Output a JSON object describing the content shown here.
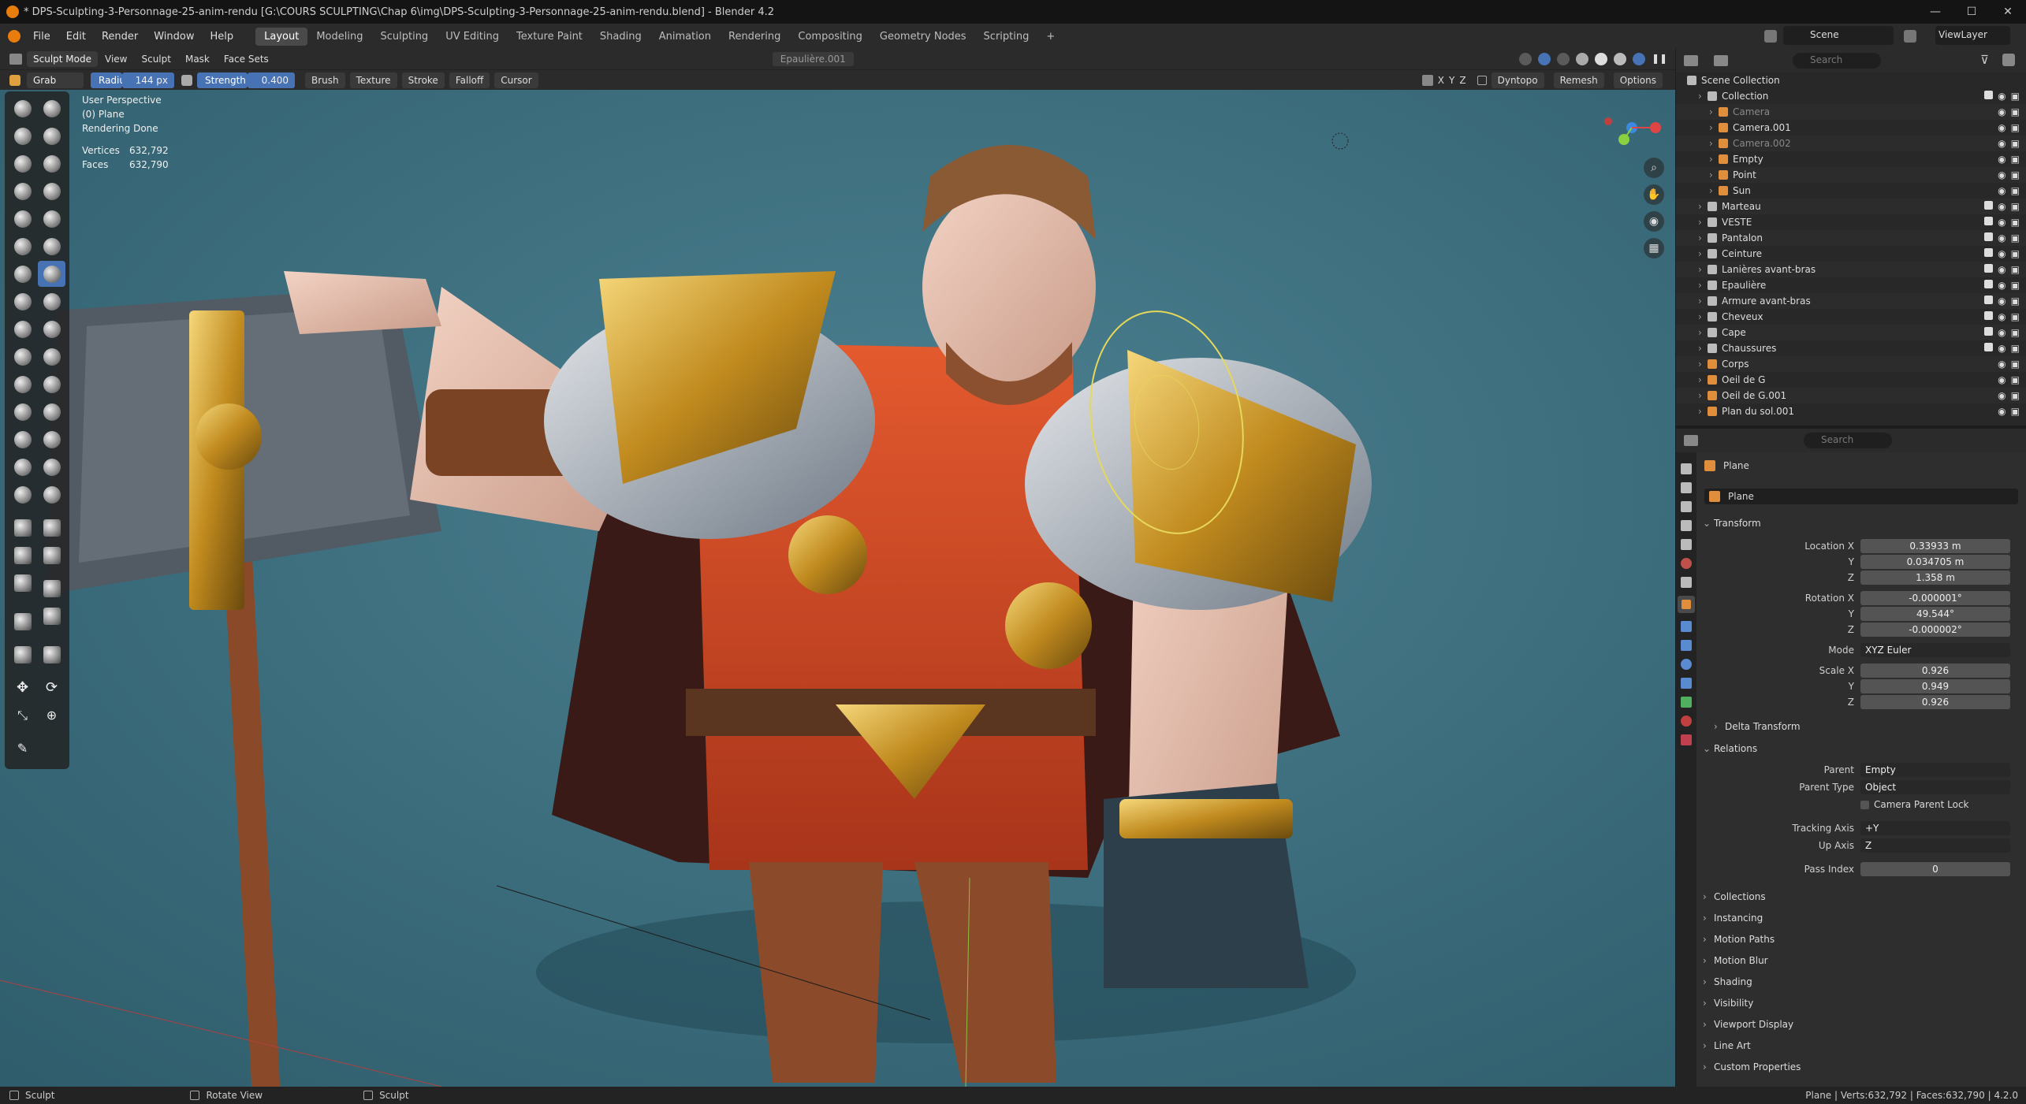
{
  "window": {
    "title": "* DPS-Sculpting-3-Personnage-25-anim-rendu [G:\\COURS SCULPTING\\Chap 6\\img\\DPS-Sculpting-3-Personnage-25-anim-rendu.blend] - Blender 4.2"
  },
  "menu": [
    "File",
    "Edit",
    "Render",
    "Window",
    "Help"
  ],
  "workspaces": [
    "Layout",
    "Modeling",
    "Sculpting",
    "UV Editing",
    "Texture Paint",
    "Shading",
    "Animation",
    "Rendering",
    "Compositing",
    "Geometry Nodes",
    "Scripting"
  ],
  "active_workspace": "Layout",
  "scene": {
    "name": "Scene",
    "view_layer": "ViewLayer"
  },
  "viewport_header": {
    "mode": "Sculpt Mode",
    "menus": [
      "View",
      "Sculpt",
      "Mask",
      "Face Sets"
    ],
    "object_field": "Epaulière.001"
  },
  "tool_header": {
    "tool": "Grab",
    "radius_label": "Radius",
    "radius_value": "144 px",
    "strength_label": "Strength",
    "strength_value": "0.400",
    "menus": [
      "Brush",
      "Texture",
      "Stroke",
      "Falloff",
      "Cursor"
    ],
    "axes": [
      "X",
      "Y",
      "Z"
    ],
    "dyntopo": "Dyntopo",
    "remesh": "Remesh",
    "options": "Options"
  },
  "viewport_info": {
    "view": "User Perspective",
    "object": "(0) Plane",
    "status": "Rendering Done",
    "vertices_label": "Vertices",
    "vertices": "632,792",
    "faces_label": "Faces",
    "faces": "632,790"
  },
  "outliner": {
    "search_placeholder": "Search",
    "root": "Scene Collection",
    "items": [
      {
        "name": "Collection",
        "depth": 1,
        "color": "#bbbbbb"
      },
      {
        "name": "Camera",
        "depth": 2,
        "color": "#e08d3c",
        "dim": true
      },
      {
        "name": "Camera.001",
        "depth": 2,
        "color": "#e08d3c"
      },
      {
        "name": "Camera.002",
        "depth": 2,
        "color": "#e08d3c",
        "dim": true
      },
      {
        "name": "Empty",
        "depth": 2,
        "color": "#e08d3c"
      },
      {
        "name": "Point",
        "depth": 2,
        "color": "#e08d3c"
      },
      {
        "name": "Sun",
        "depth": 2,
        "color": "#e08d3c"
      },
      {
        "name": "Marteau",
        "depth": 1,
        "color": "#bbbbbb"
      },
      {
        "name": "VESTE",
        "depth": 1,
        "color": "#bbbbbb"
      },
      {
        "name": "Pantalon",
        "depth": 1,
        "color": "#bbbbbb"
      },
      {
        "name": "Ceinture",
        "depth": 1,
        "color": "#bbbbbb"
      },
      {
        "name": "Lanières avant-bras",
        "depth": 1,
        "color": "#bbbbbb"
      },
      {
        "name": "Epaulière",
        "depth": 1,
        "color": "#bbbbbb"
      },
      {
        "name": "Armure avant-bras",
        "depth": 1,
        "color": "#bbbbbb"
      },
      {
        "name": "Cheveux",
        "depth": 1,
        "color": "#bbbbbb"
      },
      {
        "name": "Cape",
        "depth": 1,
        "color": "#bbbbbb"
      },
      {
        "name": "Chaussures",
        "depth": 1,
        "color": "#bbbbbb"
      },
      {
        "name": "Corps",
        "depth": 1,
        "color": "#e08d3c"
      },
      {
        "name": "Oeil de G",
        "depth": 1,
        "color": "#e08d3c"
      },
      {
        "name": "Oeil de G.001",
        "depth": 1,
        "color": "#e08d3c"
      },
      {
        "name": "Plan du sol.001",
        "depth": 1,
        "color": "#e08d3c"
      }
    ]
  },
  "properties": {
    "search_placeholder": "Search",
    "object_name": "Plane",
    "data_name": "Plane",
    "transform_label": "Transform",
    "location": {
      "label": "Location X",
      "x": "0.33933 m",
      "y": "0.034705 m",
      "z": "1.358 m"
    },
    "rotation": {
      "label": "Rotation X",
      "x": "-0.000001°",
      "y": "49.544°",
      "z": "-0.000002°"
    },
    "mode_label": "Mode",
    "mode": "XYZ Euler",
    "scale": {
      "label": "Scale X",
      "x": "0.926",
      "y": "0.949",
      "z": "0.926"
    },
    "axis_y": "Y",
    "axis_z": "Z",
    "delta_transform": "Delta Transform",
    "relations_label": "Relations",
    "parent_label": "Parent",
    "parent": "Empty",
    "parent_type_label": "Parent Type",
    "parent_type": "Object",
    "camera_parent_lock": "Camera Parent Lock",
    "tracking_axis_label": "Tracking Axis",
    "tracking_axis": "+Y",
    "up_axis_label": "Up Axis",
    "up_axis": "Z",
    "pass_index_label": "Pass Index",
    "pass_index": "0",
    "sections": [
      "Collections",
      "Instancing",
      "Motion Paths",
      "Motion Blur",
      "Shading",
      "Visibility",
      "Viewport Display",
      "Line Art",
      "Custom Properties"
    ]
  },
  "statusbar": {
    "left": "Sculpt",
    "middle": "Rotate View",
    "right_tool": "Sculpt",
    "stats": "Plane | Verts:632,792 | Faces:632,790 | 4.2.0"
  }
}
